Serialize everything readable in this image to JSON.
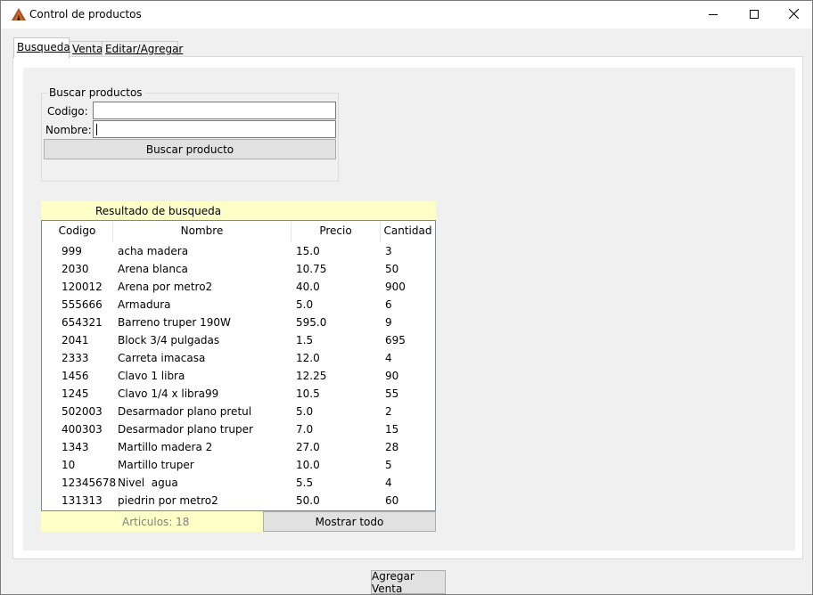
{
  "window": {
    "title": "Control de productos",
    "icon": "app-tent-icon",
    "minimize": "minimize-icon",
    "maximize": "maximize-icon",
    "close": "close-icon"
  },
  "tabs": [
    {
      "label": "Busqueda",
      "active": true
    },
    {
      "label": "Venta",
      "active": false
    },
    {
      "label": "Editar/Agregar",
      "active": false
    }
  ],
  "search": {
    "group_title": "Buscar productos",
    "codigo_label": "Codigo:",
    "codigo_value": "",
    "nombre_label": "Nombre:",
    "nombre_value": "",
    "button_label": "Buscar producto"
  },
  "results": {
    "title": "Resultado de busqueda",
    "columns": [
      "Codigo",
      "Nombre",
      "Precio",
      "Cantidad"
    ],
    "rows": [
      [
        "999",
        "acha madera",
        "15.0",
        "3"
      ],
      [
        "2030",
        "Arena blanca",
        "10.75",
        "50"
      ],
      [
        "120012",
        "Arena por metro2",
        "40.0",
        "900"
      ],
      [
        "555666",
        "Armadura",
        "5.0",
        "6"
      ],
      [
        "654321",
        "Barreno truper 190W",
        "595.0",
        "9"
      ],
      [
        "2041",
        "Block 3/4 pulgadas",
        "1.5",
        "695"
      ],
      [
        "2333",
        "Carreta imacasa",
        "12.0",
        "4"
      ],
      [
        "1456",
        "Clavo 1 libra",
        "12.25",
        "90"
      ],
      [
        "1245",
        "Clavo 1/4 x libra99",
        "10.5",
        "55"
      ],
      [
        "502003",
        "Desarmador plano pretul",
        "5.0",
        "2"
      ],
      [
        "400303",
        "Desarmador plano truper",
        "7.0",
        "15"
      ],
      [
        "1343",
        "Martillo madera 2",
        "27.0",
        "28"
      ],
      [
        "10",
        "Martillo truper",
        "10.0",
        "5"
      ],
      [
        "12345678",
        "Nivel  agua",
        "5.5",
        "4"
      ],
      [
        "131313",
        "piedrin por metro2",
        "50.0",
        "60"
      ]
    ],
    "count_text": "Articulos: 18",
    "show_all_label": "Mostrar todo"
  },
  "bottom": {
    "add_sale_label": "Agregar Venta"
  },
  "colors": {
    "highlight": "#ffffc8",
    "panel": "#f0f0f0",
    "button": "#e1e1e1"
  }
}
